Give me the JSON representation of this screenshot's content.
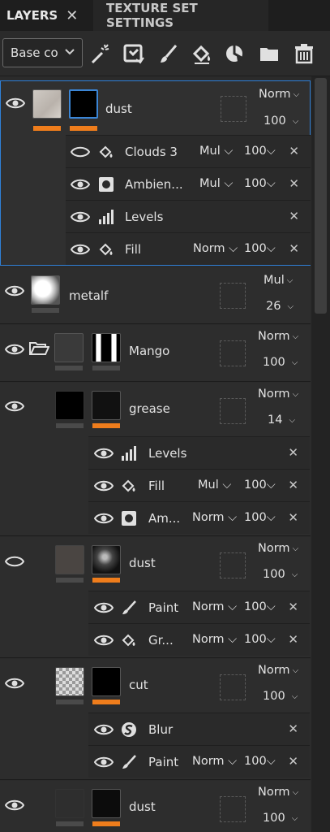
{
  "tabs": {
    "layers": "LAYERS",
    "close": "✕",
    "texture_set": "TEXTURE SET SETTINGS"
  },
  "toolbar": {
    "channel": "Base co"
  },
  "layers": [
    {
      "name": "dust",
      "blend": "Norm",
      "opacity": "100",
      "effects": [
        {
          "name": "Clouds 3",
          "blend": "Mul",
          "opacity": "100"
        },
        {
          "name": "Ambien...",
          "blend": "Mul",
          "opacity": "100"
        },
        {
          "name": "Levels"
        },
        {
          "name": "Fill",
          "blend": "Norm",
          "opacity": "100"
        }
      ]
    },
    {
      "name": "metalf",
      "blend": "Mul",
      "opacity": "26"
    },
    {
      "name": "Mango",
      "blend": "Norm",
      "opacity": "100"
    },
    {
      "name": "grease",
      "blend": "Norm",
      "opacity": "14",
      "effects": [
        {
          "name": "Levels"
        },
        {
          "name": "Fill",
          "blend": "Mul",
          "opacity": "100"
        },
        {
          "name": "Am...",
          "blend": "Norm",
          "opacity": "100"
        }
      ]
    },
    {
      "name": "dust",
      "blend": "Norm",
      "opacity": "100",
      "effects": [
        {
          "name": "Paint",
          "blend": "Norm",
          "opacity": "100"
        },
        {
          "name": "Gr...",
          "blend": "Norm",
          "opacity": "100"
        }
      ]
    },
    {
      "name": "cut",
      "blend": "Norm",
      "opacity": "100",
      "effects": [
        {
          "name": "Blur"
        },
        {
          "name": "Paint",
          "blend": "Norm",
          "opacity": "100"
        }
      ]
    },
    {
      "name": "dust",
      "blend": "Norm",
      "opacity": "100"
    }
  ],
  "colors": {
    "accent": "#ef7d1c",
    "selection": "#2f80d8",
    "panel": "#2d2d2d"
  },
  "icons": [
    "eye-icon",
    "paint-bucket-icon",
    "levels-icon",
    "ambient-occlusion-icon",
    "brush-icon",
    "blur-icon",
    "folder-icon",
    "delete-icon",
    "magic-wand-icon",
    "smart-mask-icon",
    "fill-layer-icon",
    "add-mask-icon"
  ]
}
